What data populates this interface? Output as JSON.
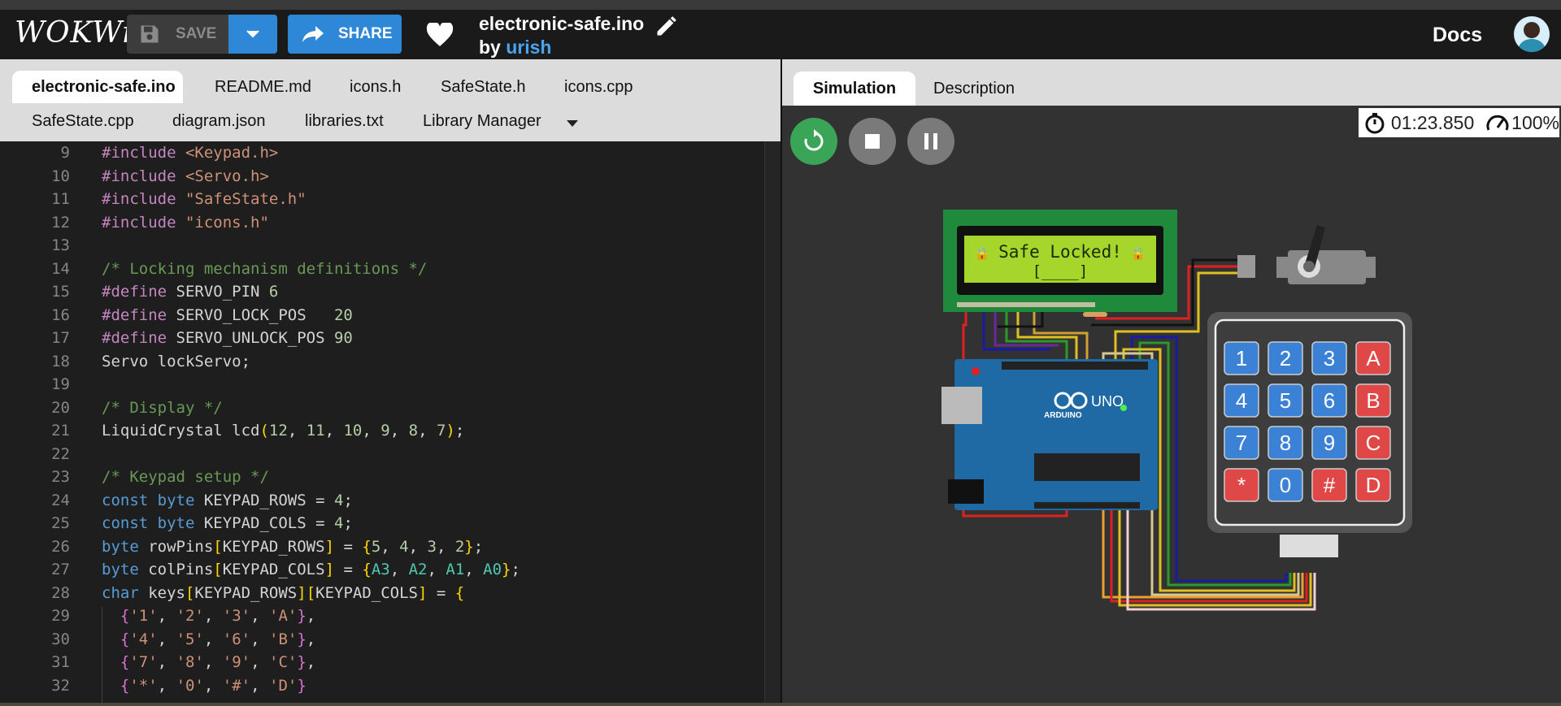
{
  "header": {
    "logo": "WOKWi",
    "save_label": "SAVE",
    "share_label": "SHARE",
    "project_title": "electronic-safe.ino",
    "by_label": "by",
    "author": "urish",
    "docs_label": "Docs"
  },
  "editor": {
    "tabs_row1": [
      "electronic-safe.ino",
      "README.md",
      "icons.h",
      "SafeState.h",
      "icons.cpp"
    ],
    "tabs_row2": [
      "SafeState.cpp",
      "diagram.json",
      "libraries.txt",
      "Library Manager"
    ],
    "active_tab": "electronic-safe.ino",
    "line_numbers": [
      "9",
      "10",
      "11",
      "12",
      "13",
      "14",
      "15",
      "16",
      "17",
      "18",
      "19",
      "20",
      "21",
      "22",
      "23",
      "24",
      "25",
      "26",
      "27",
      "28",
      "29",
      "30",
      "31",
      "32"
    ],
    "code_lines": [
      "#include <Keypad.h>",
      "#include <Servo.h>",
      "#include \"SafeState.h\"",
      "#include \"icons.h\"",
      "",
      "/* Locking mechanism definitions */",
      "#define SERVO_PIN 6",
      "#define SERVO_LOCK_POS   20",
      "#define SERVO_UNLOCK_POS 90",
      "Servo lockServo;",
      "",
      "/* Display */",
      "LiquidCrystal lcd(12, 11, 10, 9, 8, 7);",
      "",
      "/* Keypad setup */",
      "const byte KEYPAD_ROWS = 4;",
      "const byte KEYPAD_COLS = 4;",
      "byte rowPins[KEYPAD_ROWS] = {5, 4, 3, 2};",
      "byte colPins[KEYPAD_COLS] = {A3, A2, A1, A0};",
      "char keys[KEYPAD_ROWS][KEYPAD_COLS] = {",
      "  {'1', '2', '3', 'A'},",
      "  {'4', '5', '6', 'B'},",
      "  {'7', '8', '9', 'C'},",
      "  {'*', '0', '#', 'D'}"
    ]
  },
  "simulation": {
    "tabs": [
      "Simulation",
      "Description"
    ],
    "active_tab": "Simulation",
    "timer": "01:23.850",
    "speed": "100%",
    "lcd_line1": "Safe Locked!",
    "lcd_line2": "[____]",
    "arduino_label": "UNO",
    "arduino_brand": "ARDUINO",
    "keypad_keys": [
      "1",
      "2",
      "3",
      "A",
      "4",
      "5",
      "6",
      "B",
      "7",
      "8",
      "9",
      "C",
      "*",
      "0",
      "#",
      "D"
    ]
  },
  "colors": {
    "accent": "#2f87d8",
    "play_green": "#3aa457",
    "keypad_blue": "#3b82d6",
    "keypad_red": "#e04848",
    "lcd_green": "#a6d62b",
    "pcb_green": "#1f8a3c"
  }
}
